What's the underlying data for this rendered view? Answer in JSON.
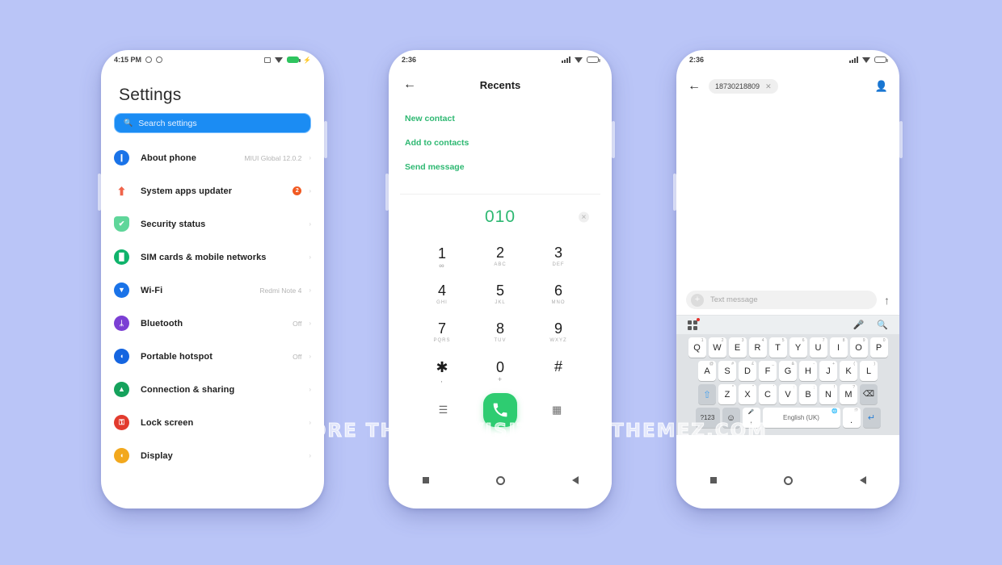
{
  "watermark": "FOR MORE THEMES VISIT - MIUITHEMEZ.COM",
  "phone1": {
    "status": {
      "time": "4:15 PM",
      "alarm_icon": "alarm-icon",
      "dnd_icon": "dnd-icon",
      "vibrate_icon": "vibrate-icon",
      "wifi_icon": "wifi-icon",
      "battery_icon": "battery-full-icon",
      "charging_icon": "charging-bolt-icon"
    },
    "title": "Settings",
    "search": {
      "placeholder": "Search settings",
      "icon": "search-icon"
    },
    "items": [
      {
        "label": "About phone",
        "value": "MIUI Global 12.0.2",
        "badge": "",
        "icon": "phone-info-icon",
        "color": "#1a73e8",
        "glyph": "❙"
      },
      {
        "label": "System apps updater",
        "value": "",
        "badge": "2",
        "icon": "up-arrow-icon",
        "color": "#ffffff",
        "glyph": "⬆"
      },
      {
        "label": "Security status",
        "value": "",
        "badge": "",
        "icon": "shield-check-icon",
        "color": "#ffffff",
        "glyph": "✔"
      },
      {
        "label": "SIM cards & mobile networks",
        "value": "",
        "badge": "",
        "icon": "sim-signal-icon",
        "color": "#0fb36b",
        "glyph": "█"
      },
      {
        "label": "Wi-Fi",
        "value": "Redmi Note 4",
        "badge": "",
        "icon": "wifi-icon",
        "color": "#1a73e8",
        "glyph": "▼"
      },
      {
        "label": "Bluetooth",
        "value": "Off",
        "badge": "",
        "icon": "bluetooth-icon",
        "color": "#7b3fd4",
        "glyph": "ᛦ"
      },
      {
        "label": "Portable hotspot",
        "value": "Off",
        "badge": "",
        "icon": "hotspot-icon",
        "color": "#1565e0",
        "glyph": "◖"
      },
      {
        "label": "Connection & sharing",
        "value": "",
        "badge": "",
        "icon": "share-icon",
        "color": "#15a25c",
        "glyph": "▲"
      },
      {
        "label": "Lock screen",
        "value": "",
        "badge": "",
        "icon": "lock-icon",
        "color": "#e23b2e",
        "glyph": "⚿"
      },
      {
        "label": "Display",
        "value": "",
        "badge": "",
        "icon": "brightness-icon",
        "color": "#f2a81d",
        "glyph": "◖"
      }
    ],
    "chevron": "›"
  },
  "phone2": {
    "status": {
      "time": "2:36",
      "signal_icon": "signal-icon",
      "wifi_icon": "wifi-icon",
      "battery_icon": "battery-icon"
    },
    "back_icon": "back-arrow-icon",
    "title": "Recents",
    "actions": [
      {
        "label": "New contact"
      },
      {
        "label": "Add to contacts"
      },
      {
        "label": "Send message"
      }
    ],
    "dial": {
      "number": "010",
      "clear_icon": "clear-input-icon",
      "keys": [
        {
          "num": "1",
          "sub": "∞"
        },
        {
          "num": "2",
          "sub": "ABC"
        },
        {
          "num": "3",
          "sub": "DEF"
        },
        {
          "num": "4",
          "sub": "GHI"
        },
        {
          "num": "5",
          "sub": "JKL"
        },
        {
          "num": "6",
          "sub": "MNO"
        },
        {
          "num": "7",
          "sub": "PQRS"
        },
        {
          "num": "8",
          "sub": "TUV"
        },
        {
          "num": "9",
          "sub": "WXYZ"
        },
        {
          "num": "✱",
          "sub": ","
        },
        {
          "num": "0",
          "sub": "+"
        },
        {
          "num": "#",
          "sub": ""
        }
      ],
      "menu_icon": "menu-icon",
      "call_icon": "call-button",
      "keypad_icon": "keypad-icon"
    },
    "nav": {
      "recents_icon": "recents-square-icon",
      "home_icon": "home-circle-icon",
      "back_icon": "back-triangle-icon"
    }
  },
  "phone3": {
    "status": {
      "time": "2:36",
      "signal_icon": "signal-icon",
      "wifi_icon": "wifi-icon",
      "battery_icon": "battery-icon"
    },
    "back_icon": "back-arrow-icon",
    "recipient": {
      "number": "18730218809",
      "remove_icon": "remove-chip-icon"
    },
    "contact_icon": "add-contact-icon",
    "compose": {
      "placeholder": "Text message",
      "attach_icon": "plus-attach-icon",
      "send_icon": "send-arrow-icon"
    },
    "kb_toolbar": {
      "apps_icon": "keyboard-apps-icon",
      "mic_icon": "microphone-icon",
      "search_icon": "search-icon"
    },
    "keyboard": {
      "row1": [
        {
          "k": "Q",
          "sup": "1"
        },
        {
          "k": "W",
          "sup": "2"
        },
        {
          "k": "E",
          "sup": "3"
        },
        {
          "k": "R",
          "sup": "4"
        },
        {
          "k": "T",
          "sup": "5"
        },
        {
          "k": "Y",
          "sup": "6"
        },
        {
          "k": "U",
          "sup": "7"
        },
        {
          "k": "I",
          "sup": "8"
        },
        {
          "k": "O",
          "sup": "9"
        },
        {
          "k": "P",
          "sup": "0"
        }
      ],
      "row2": [
        {
          "k": "A",
          "sup": "@"
        },
        {
          "k": "S",
          "sup": "#"
        },
        {
          "k": "D",
          "sup": "£"
        },
        {
          "k": "F",
          "sup": "_"
        },
        {
          "k": "G",
          "sup": "&"
        },
        {
          "k": "H",
          "sup": "-"
        },
        {
          "k": "J",
          "sup": "+"
        },
        {
          "k": "K",
          "sup": "("
        },
        {
          "k": "L",
          "sup": ")"
        }
      ],
      "row3": [
        {
          "k": "Z",
          "sup": "*"
        },
        {
          "k": "X",
          "sup": "\""
        },
        {
          "k": "C",
          "sup": "'"
        },
        {
          "k": "V",
          "sup": ":"
        },
        {
          "k": "B",
          "sup": ";"
        },
        {
          "k": "N",
          "sup": "!"
        },
        {
          "k": "M",
          "sup": "?"
        }
      ],
      "shift_icon": "shift-icon",
      "backspace_icon": "backspace-icon",
      "symbols_label": "?123",
      "emoji_icon": "emoji-icon",
      "comma_key": {
        "k": ",",
        "sup": "🎤"
      },
      "space_label": "English (UK)",
      "globe_icon": "language-globe-icon",
      "period_key": {
        "k": ".",
        "sup": "!?"
      },
      "enter_icon": "enter-icon"
    },
    "nav": {
      "recents_icon": "recents-square-icon",
      "home_icon": "home-circle-icon",
      "back_icon": "back-triangle-icon"
    }
  }
}
